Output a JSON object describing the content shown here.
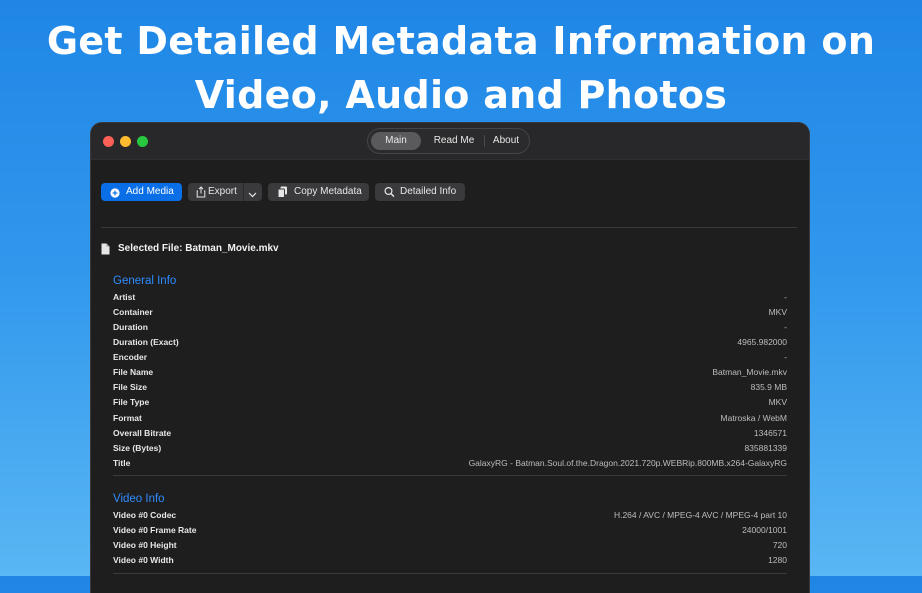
{
  "headline": {
    "line1": "Get Detailed Metadata Information on",
    "line2": "Video, Audio and Photos"
  },
  "titlebar": {
    "tabs": [
      {
        "label": "Main",
        "selected": true
      },
      {
        "label": "Read Me",
        "selected": false
      },
      {
        "label": "About",
        "selected": false
      }
    ]
  },
  "toolbar": {
    "add_media": "Add Media",
    "export": "Export",
    "copy_metadata": "Copy Metadata",
    "detailed_info": "Detailed Info"
  },
  "selected_file": "Selected File: Batman_Movie.mkv",
  "general_info": {
    "title": "General Info",
    "rows": [
      {
        "key": "Artist",
        "value": "-"
      },
      {
        "key": "Container",
        "value": "MKV"
      },
      {
        "key": "Duration",
        "value": "-"
      },
      {
        "key": "Duration (Exact)",
        "value": "4965.982000"
      },
      {
        "key": "Encoder",
        "value": "-"
      },
      {
        "key": "File Name",
        "value": "Batman_Movie.mkv"
      },
      {
        "key": "File Size",
        "value": "835.9 MB"
      },
      {
        "key": "File Type",
        "value": "MKV"
      },
      {
        "key": "Format",
        "value": "Matroska / WebM"
      },
      {
        "key": "Overall Bitrate",
        "value": "1346571"
      },
      {
        "key": "Size (Bytes)",
        "value": "835881339"
      },
      {
        "key": "Title",
        "value": "GalaxyRG - Batman.Soul.of.the.Dragon.2021.720p.WEBRip.800MB.x264-GalaxyRG"
      }
    ]
  },
  "video_info": {
    "title": "Video Info",
    "rows": [
      {
        "key": "Video #0 Codec",
        "value": "H.264 / AVC / MPEG-4 AVC / MPEG-4 part 10"
      },
      {
        "key": "Video #0 Frame Rate",
        "value": "24000/1001"
      },
      {
        "key": "Video #0 Height",
        "value": "720"
      },
      {
        "key": "Video #0 Width",
        "value": "1280"
      }
    ]
  },
  "colors": {
    "accent": "#0a6fe6",
    "section_title": "#2f8cff",
    "window_bg": "#1e1e1f"
  }
}
